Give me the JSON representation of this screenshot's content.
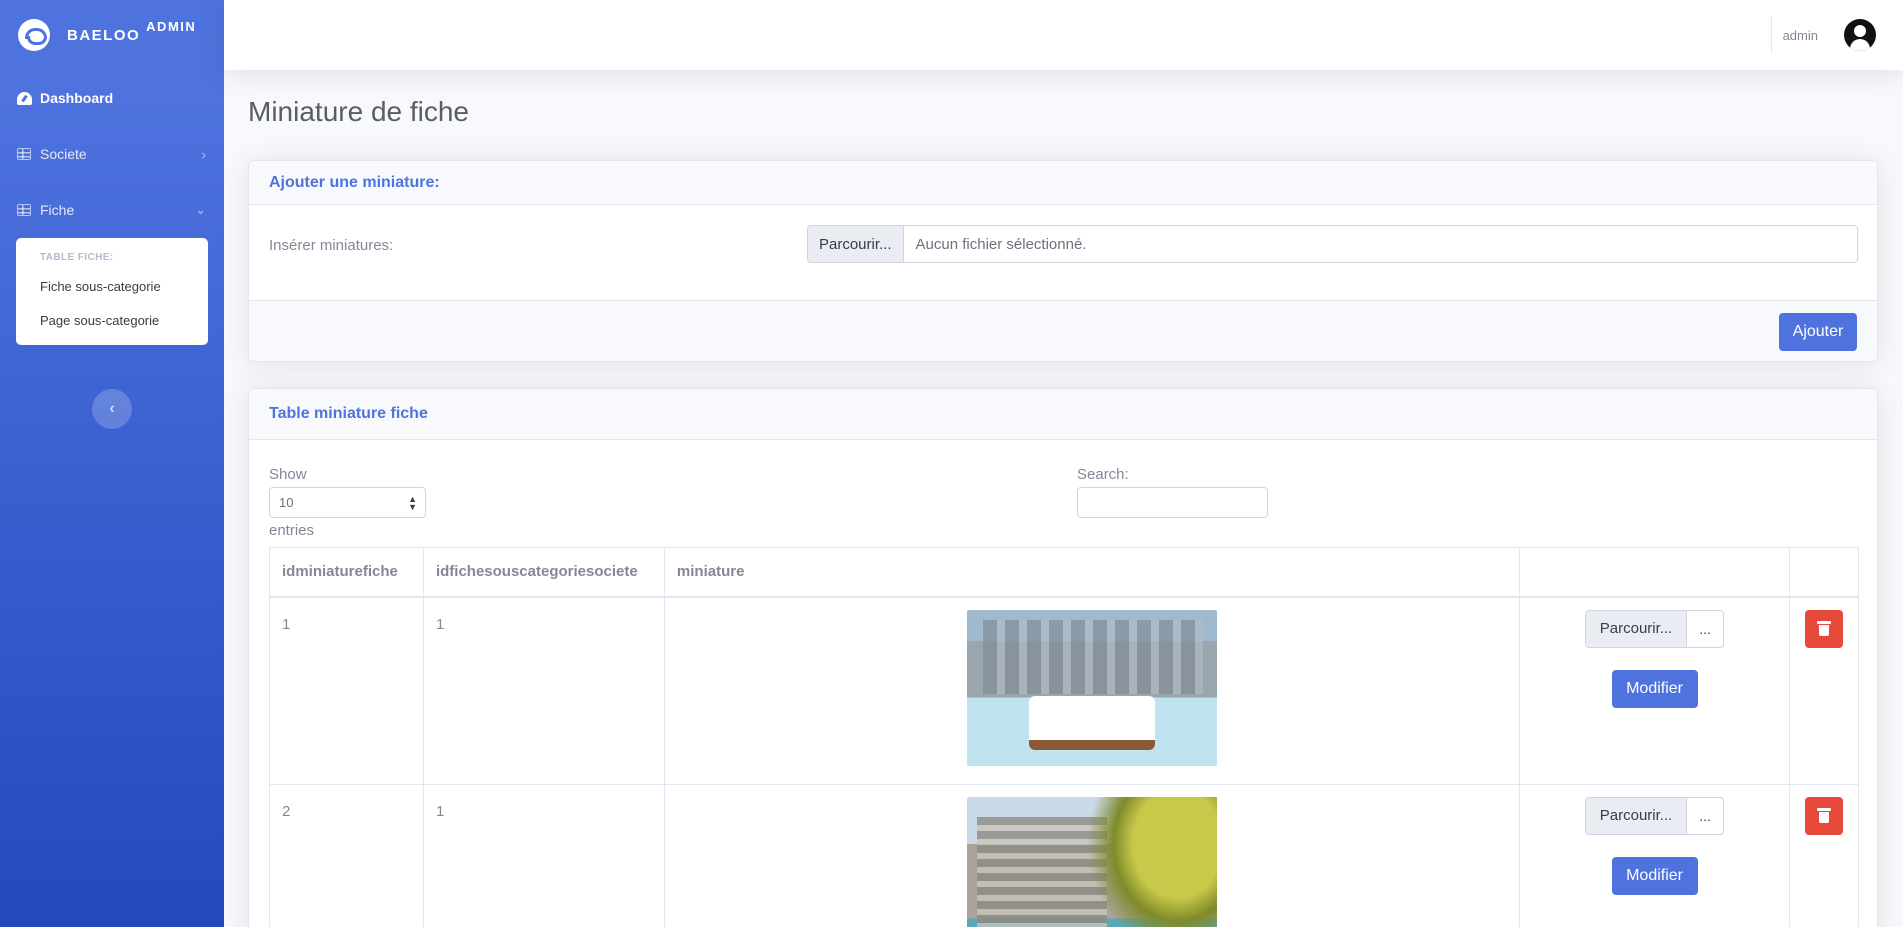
{
  "brand": {
    "name": "Baeloo",
    "suffix": "Admin"
  },
  "sidebar": {
    "items": [
      {
        "label": "Dashboard",
        "icon": "tachometer-icon"
      },
      {
        "label": "Societe",
        "icon": "table-icon"
      },
      {
        "label": "Fiche",
        "icon": "table-icon"
      }
    ],
    "submenu": {
      "header": "Table fiche:",
      "items": [
        {
          "label": "Fiche sous-categorie"
        },
        {
          "label": "Page sous-categorie"
        }
      ]
    },
    "toggle_glyph": "‹"
  },
  "topbar": {
    "user_name": "admin"
  },
  "page": {
    "title": "Miniature de fiche"
  },
  "add_card": {
    "header": "Ajouter une miniature:",
    "label": "Insérer miniatures:",
    "browse_label": "Parcourir...",
    "file_status": "Aucun fichier sélectionné.",
    "submit_label": "Ajouter"
  },
  "table_card": {
    "header": "Table miniature fiche",
    "show_label": "Show",
    "entries_value": "10",
    "entries_label": "entries",
    "search_label": "Search:",
    "columns": [
      "idminiaturefiche",
      "idfichesouscategoriesociete",
      "miniature",
      "",
      ""
    ],
    "rows": [
      {
        "id": "1",
        "fiche_id": "1",
        "image": "hotel-pool-image",
        "browse_label": "Parcourir...",
        "ellipsis": "...",
        "modify_label": "Modifier"
      },
      {
        "id": "2",
        "fiche_id": "1",
        "image": "hotel-palm-image",
        "browse_label": "Parcourir...",
        "ellipsis": "...",
        "modify_label": "Modifier"
      }
    ]
  },
  "colors": {
    "primary": "#4e73df",
    "danger": "#e74a3b",
    "sidebar_dark": "#224abe"
  }
}
